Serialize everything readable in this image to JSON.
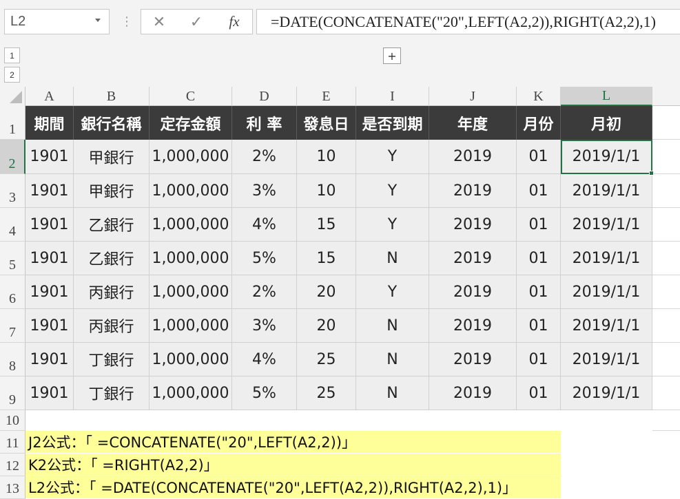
{
  "name_box": "L2",
  "formula_bar": {
    "cancel_icon": "✕",
    "enter_icon": "✓",
    "fx_label": "fx",
    "formula": "=DATE(CONCATENATE(\"20\",LEFT(A2,2)),RIGHT(A2,2),1)"
  },
  "outline_levels": [
    "1",
    "2"
  ],
  "expand_label": "+",
  "columns": [
    "A",
    "B",
    "C",
    "D",
    "E",
    "I",
    "J",
    "K",
    "L"
  ],
  "row_numbers": [
    "1",
    "2",
    "3",
    "4",
    "5",
    "6",
    "7",
    "8",
    "9",
    "10",
    "11",
    "12",
    "13"
  ],
  "headers": [
    "期間",
    "銀行名稱",
    "定存金額",
    "利 率",
    "發息日",
    "是否到期",
    "年度",
    "月份",
    "月初"
  ],
  "rows": [
    [
      "1901",
      "甲銀行",
      "1,000,000",
      "2%",
      "10",
      "Y",
      "2019",
      "01",
      "2019/1/1"
    ],
    [
      "1901",
      "甲銀行",
      "1,000,000",
      "3%",
      "10",
      "Y",
      "2019",
      "01",
      "2019/1/1"
    ],
    [
      "1901",
      "乙銀行",
      "1,000,000",
      "4%",
      "15",
      "Y",
      "2019",
      "01",
      "2019/1/1"
    ],
    [
      "1901",
      "乙銀行",
      "1,000,000",
      "5%",
      "15",
      "N",
      "2019",
      "01",
      "2019/1/1"
    ],
    [
      "1901",
      "丙銀行",
      "1,000,000",
      "2%",
      "20",
      "Y",
      "2019",
      "01",
      "2019/1/1"
    ],
    [
      "1901",
      "丙銀行",
      "1,000,000",
      "3%",
      "20",
      "N",
      "2019",
      "01",
      "2019/1/1"
    ],
    [
      "1901",
      "丁銀行",
      "1,000,000",
      "4%",
      "25",
      "N",
      "2019",
      "01",
      "2019/1/1"
    ],
    [
      "1901",
      "丁銀行",
      "1,000,000",
      "5%",
      "25",
      "N",
      "2019",
      "01",
      "2019/1/1"
    ]
  ],
  "notes": [
    "J2公式：「 =CONCATENATE(\"20\",LEFT(A2,2))」",
    "K2公式：「 =RIGHT(A2,2)」",
    "L2公式：「 =DATE(CONCATENATE(\"20\",LEFT(A2,2)),RIGHT(A2,2),1)」"
  ],
  "colors": {
    "header_bg": "#3b3b3b",
    "cell_bg": "#eeeeee",
    "note_bg": "#ffff99",
    "selection": "#217346"
  }
}
